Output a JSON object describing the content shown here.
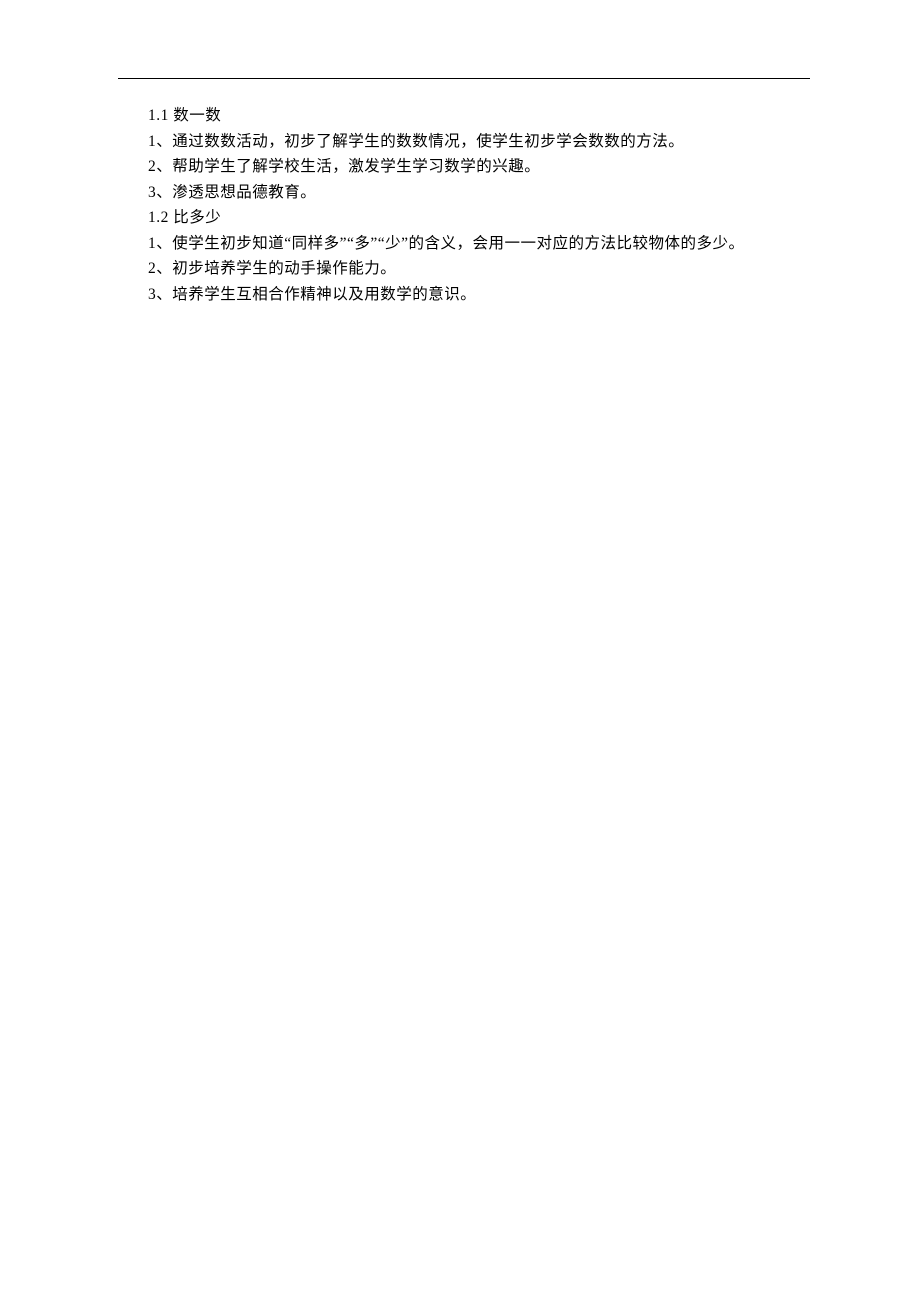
{
  "lines": [
    "1.1 数一数",
    "1、通过数数活动，初步了解学生的数数情况，使学生初步学会数数的方法。",
    "2、帮助学生了解学校生活，激发学生学习数学的兴趣。",
    "3、渗透思想品德教育。",
    "1.2 比多少",
    "1、使学生初步知道“同样多”“多”“少”的含义，会用一一对应的方法比较物体的多少。",
    "2、初步培养学生的动手操作能力。",
    "3、培养学生互相合作精神以及用数学的意识。"
  ]
}
